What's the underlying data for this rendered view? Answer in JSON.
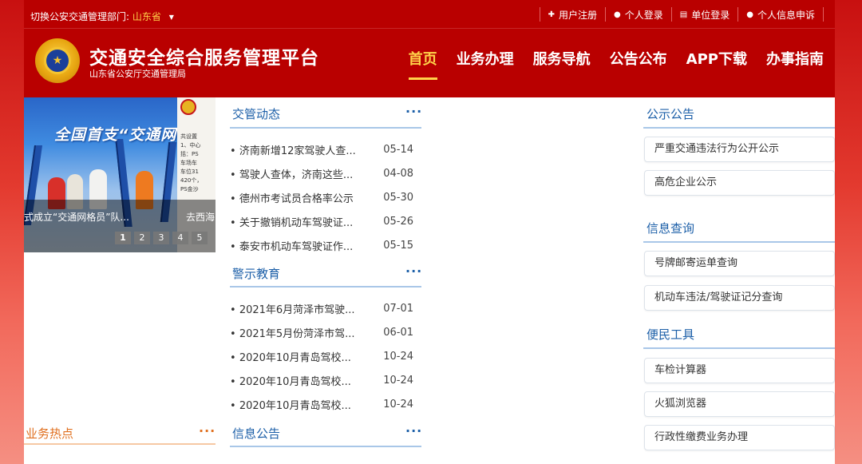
{
  "topbar": {
    "dept_label": "切换公安交通管理部门:",
    "dept_value": "山东省",
    "links": [
      "用户注册",
      "个人登录",
      "单位登录",
      "个人信息申诉"
    ]
  },
  "brand": {
    "title": "交通安全综合服务管理平台",
    "subtitle": "山东省公安厅交通管理局"
  },
  "nav": [
    "首页",
    "业务办理",
    "服务导航",
    "公告公布",
    "APP下载",
    "办事指南"
  ],
  "slider": {
    "banner_text": "全国首支“交通网",
    "captions": [
      "式成立“交通网格员”队...",
      "去西海"
    ],
    "doc_text": "共设置\n1、中心\n括：PS\n车场车\n车位31\n420个，\nPS金沙",
    "dots": [
      "1",
      "2",
      "3",
      "4",
      "5"
    ],
    "active_dot": 1
  },
  "traffic_news": {
    "title": "交管动态",
    "more": "···",
    "items": [
      {
        "title": "济南新增12家驾驶人查...",
        "date": "05-14"
      },
      {
        "title": "驾驶人查体，济南这些...",
        "date": "04-08"
      },
      {
        "title": "德州市考试员合格率公示",
        "date": "05-30"
      },
      {
        "title": "关于撤销机动车驾驶证...",
        "date": "05-26"
      },
      {
        "title": "泰安市机动车驾驶证作...",
        "date": "05-15"
      }
    ]
  },
  "warning_edu": {
    "title": "警示教育",
    "more": "···",
    "items": [
      {
        "title": "2021年6月菏泽市驾驶...",
        "date": "07-01"
      },
      {
        "title": "2021年5月份菏泽市驾...",
        "date": "06-01"
      },
      {
        "title": "2020年10月青岛驾校...",
        "date": "10-24"
      },
      {
        "title": "2020年10月青岛驾校...",
        "date": "10-24"
      },
      {
        "title": "2020年10月青岛驾校...",
        "date": "10-24"
      }
    ]
  },
  "info_notice": {
    "title": "信息公告",
    "more": "···"
  },
  "hot": {
    "title": "业务热点",
    "more": "···"
  },
  "public_notice": {
    "title": "公示公告",
    "items": [
      "严重交通违法行为公开公示",
      "高危企业公示"
    ]
  },
  "info_query": {
    "title": "信息查询",
    "items": [
      "号牌邮寄运单查询",
      "机动车违法/驾驶证记分查询"
    ]
  },
  "tools": {
    "title": "便民工具",
    "items": [
      "车检计算器",
      "火狐浏览器",
      "行政性缴费业务办理"
    ]
  },
  "colors": {
    "header": "#b90000",
    "accent": "#ffd24a",
    "link_blue": "#1c5fa8",
    "hot_orange": "#e07020"
  }
}
